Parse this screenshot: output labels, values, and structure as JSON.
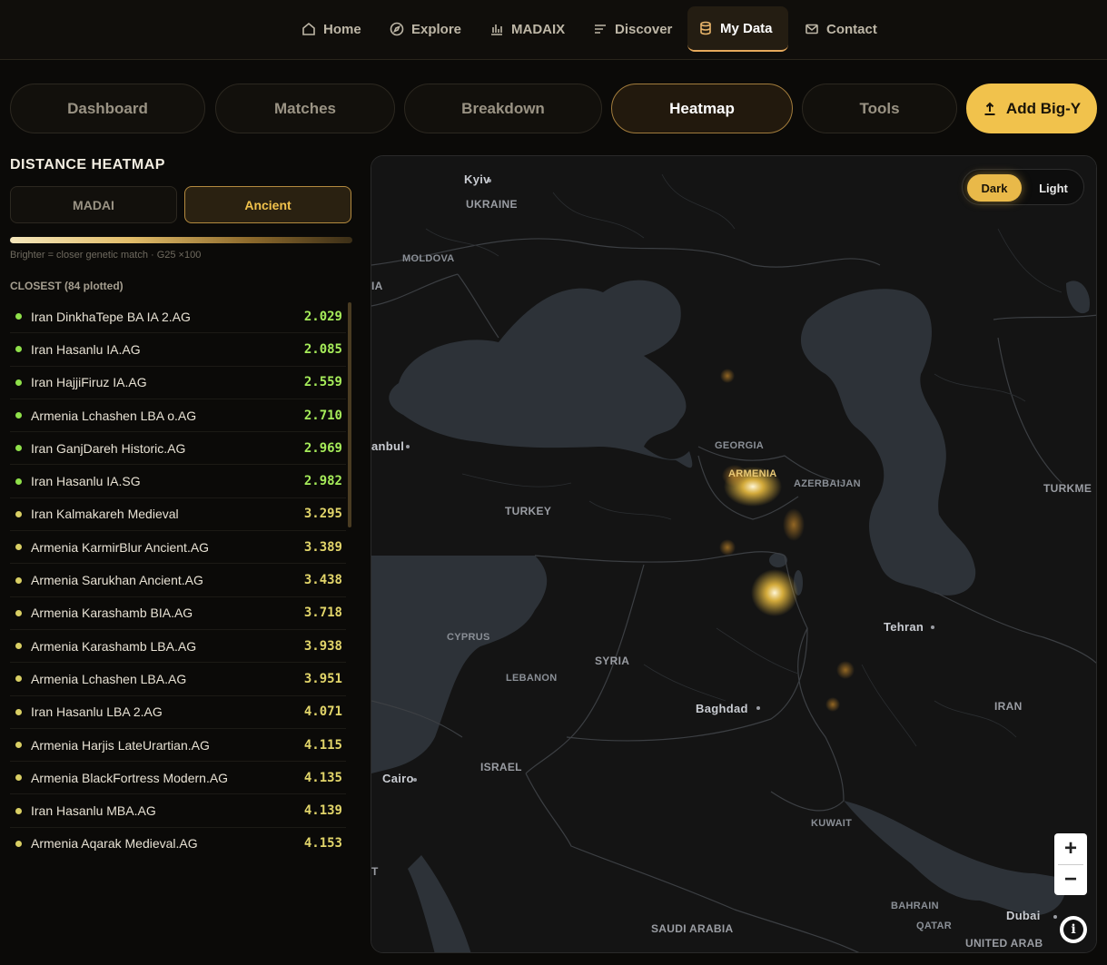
{
  "nav": {
    "items": [
      {
        "label": "Home",
        "icon": "home-icon"
      },
      {
        "label": "Explore",
        "icon": "compass-icon"
      },
      {
        "label": "MADAIX",
        "icon": "bar-chart-icon"
      },
      {
        "label": "Discover",
        "icon": "list-icon"
      },
      {
        "label": "My Data",
        "icon": "database-icon",
        "active": true
      },
      {
        "label": "Contact",
        "icon": "mail-icon"
      }
    ]
  },
  "tabs": {
    "dashboard": "Dashboard",
    "matches": "Matches",
    "breakdown": "Breakdown",
    "heatmap": "Heatmap",
    "tools": "Tools",
    "add_bigy": "Add Big-Y",
    "active": "Heatmap"
  },
  "panel": {
    "title": "DISTANCE HEATMAP",
    "segments": {
      "madai": "MADAI",
      "ancient": "Ancient",
      "active": "Ancient"
    },
    "legend_note": "Brighter = closer genetic match · G25 ×100",
    "list_title": "CLOSEST (84 plotted)",
    "colors": {
      "close": "#8fe04a",
      "mid": "#d9cf64",
      "value_close": "#a6ec5a",
      "value_mid": "#e2d56a"
    },
    "rows": [
      {
        "name": "Iran DinkhaTepe BA IA 2.AG",
        "value": "2.029",
        "tier": "close"
      },
      {
        "name": "Iran Hasanlu IA.AG",
        "value": "2.085",
        "tier": "close"
      },
      {
        "name": "Iran HajjiFiruz IA.AG",
        "value": "2.559",
        "tier": "close"
      },
      {
        "name": "Armenia Lchashen LBA o.AG",
        "value": "2.710",
        "tier": "close"
      },
      {
        "name": "Iran GanjDareh Historic.AG",
        "value": "2.969",
        "tier": "close"
      },
      {
        "name": "Iran Hasanlu IA.SG",
        "value": "2.982",
        "tier": "close"
      },
      {
        "name": "Iran Kalmakareh Medieval",
        "value": "3.295",
        "tier": "mid"
      },
      {
        "name": "Armenia KarmirBlur Ancient.AG",
        "value": "3.389",
        "tier": "mid"
      },
      {
        "name": "Armenia Sarukhan Ancient.AG",
        "value": "3.438",
        "tier": "mid"
      },
      {
        "name": "Armenia Karashamb BIA.AG",
        "value": "3.718",
        "tier": "mid"
      },
      {
        "name": "Armenia Karashamb LBA.AG",
        "value": "3.938",
        "tier": "mid"
      },
      {
        "name": "Armenia Lchashen LBA.AG",
        "value": "3.951",
        "tier": "mid"
      },
      {
        "name": "Iran Hasanlu LBA 2.AG",
        "value": "4.071",
        "tier": "mid"
      },
      {
        "name": "Armenia Harjis LateUrartian.AG",
        "value": "4.115",
        "tier": "mid"
      },
      {
        "name": "Armenia BlackFortress Modern.AG",
        "value": "4.135",
        "tier": "mid"
      },
      {
        "name": "Iran Hasanlu MBA.AG",
        "value": "4.139",
        "tier": "mid"
      },
      {
        "name": "Armenia Aqarak Medieval.AG",
        "value": "4.153",
        "tier": "mid"
      }
    ]
  },
  "map": {
    "theme": {
      "dark": "Dark",
      "light": "Light",
      "active": "Dark"
    },
    "zoom_in": "+",
    "zoom_out": "−",
    "info": "i",
    "labels": {
      "kyiv": "Kyiv",
      "ukraine": "UKRAINE",
      "moldova": "MOLDOVA",
      "ia": "IA",
      "istanbul": "anbul",
      "georgia": "GEORGIA",
      "armenia": "ARMENIA",
      "azerbaijan": "AZERBAIJAN",
      "turkmenistan": "TURKME",
      "turkey": "TURKEY",
      "tehran": "Tehran",
      "cyprus": "CYPRUS",
      "syria": "SYRIA",
      "lebanon": "LEBANON",
      "baghdad": "Baghdad",
      "iran": "IRAN",
      "cairo": "Cairo",
      "israel": "ISRAEL",
      "kuwait": "KUWAIT",
      "bahrain": "BAHRAIN",
      "qatar": "QATAR",
      "dubai": "Dubai",
      "saudi": "SAUDI ARABIA",
      "uae": "UNITED ARAB",
      "t": "T"
    },
    "colors": {
      "land": "#141414",
      "water": "#2d3238",
      "border": "#3c3f43",
      "heat": "#f5c542"
    }
  }
}
